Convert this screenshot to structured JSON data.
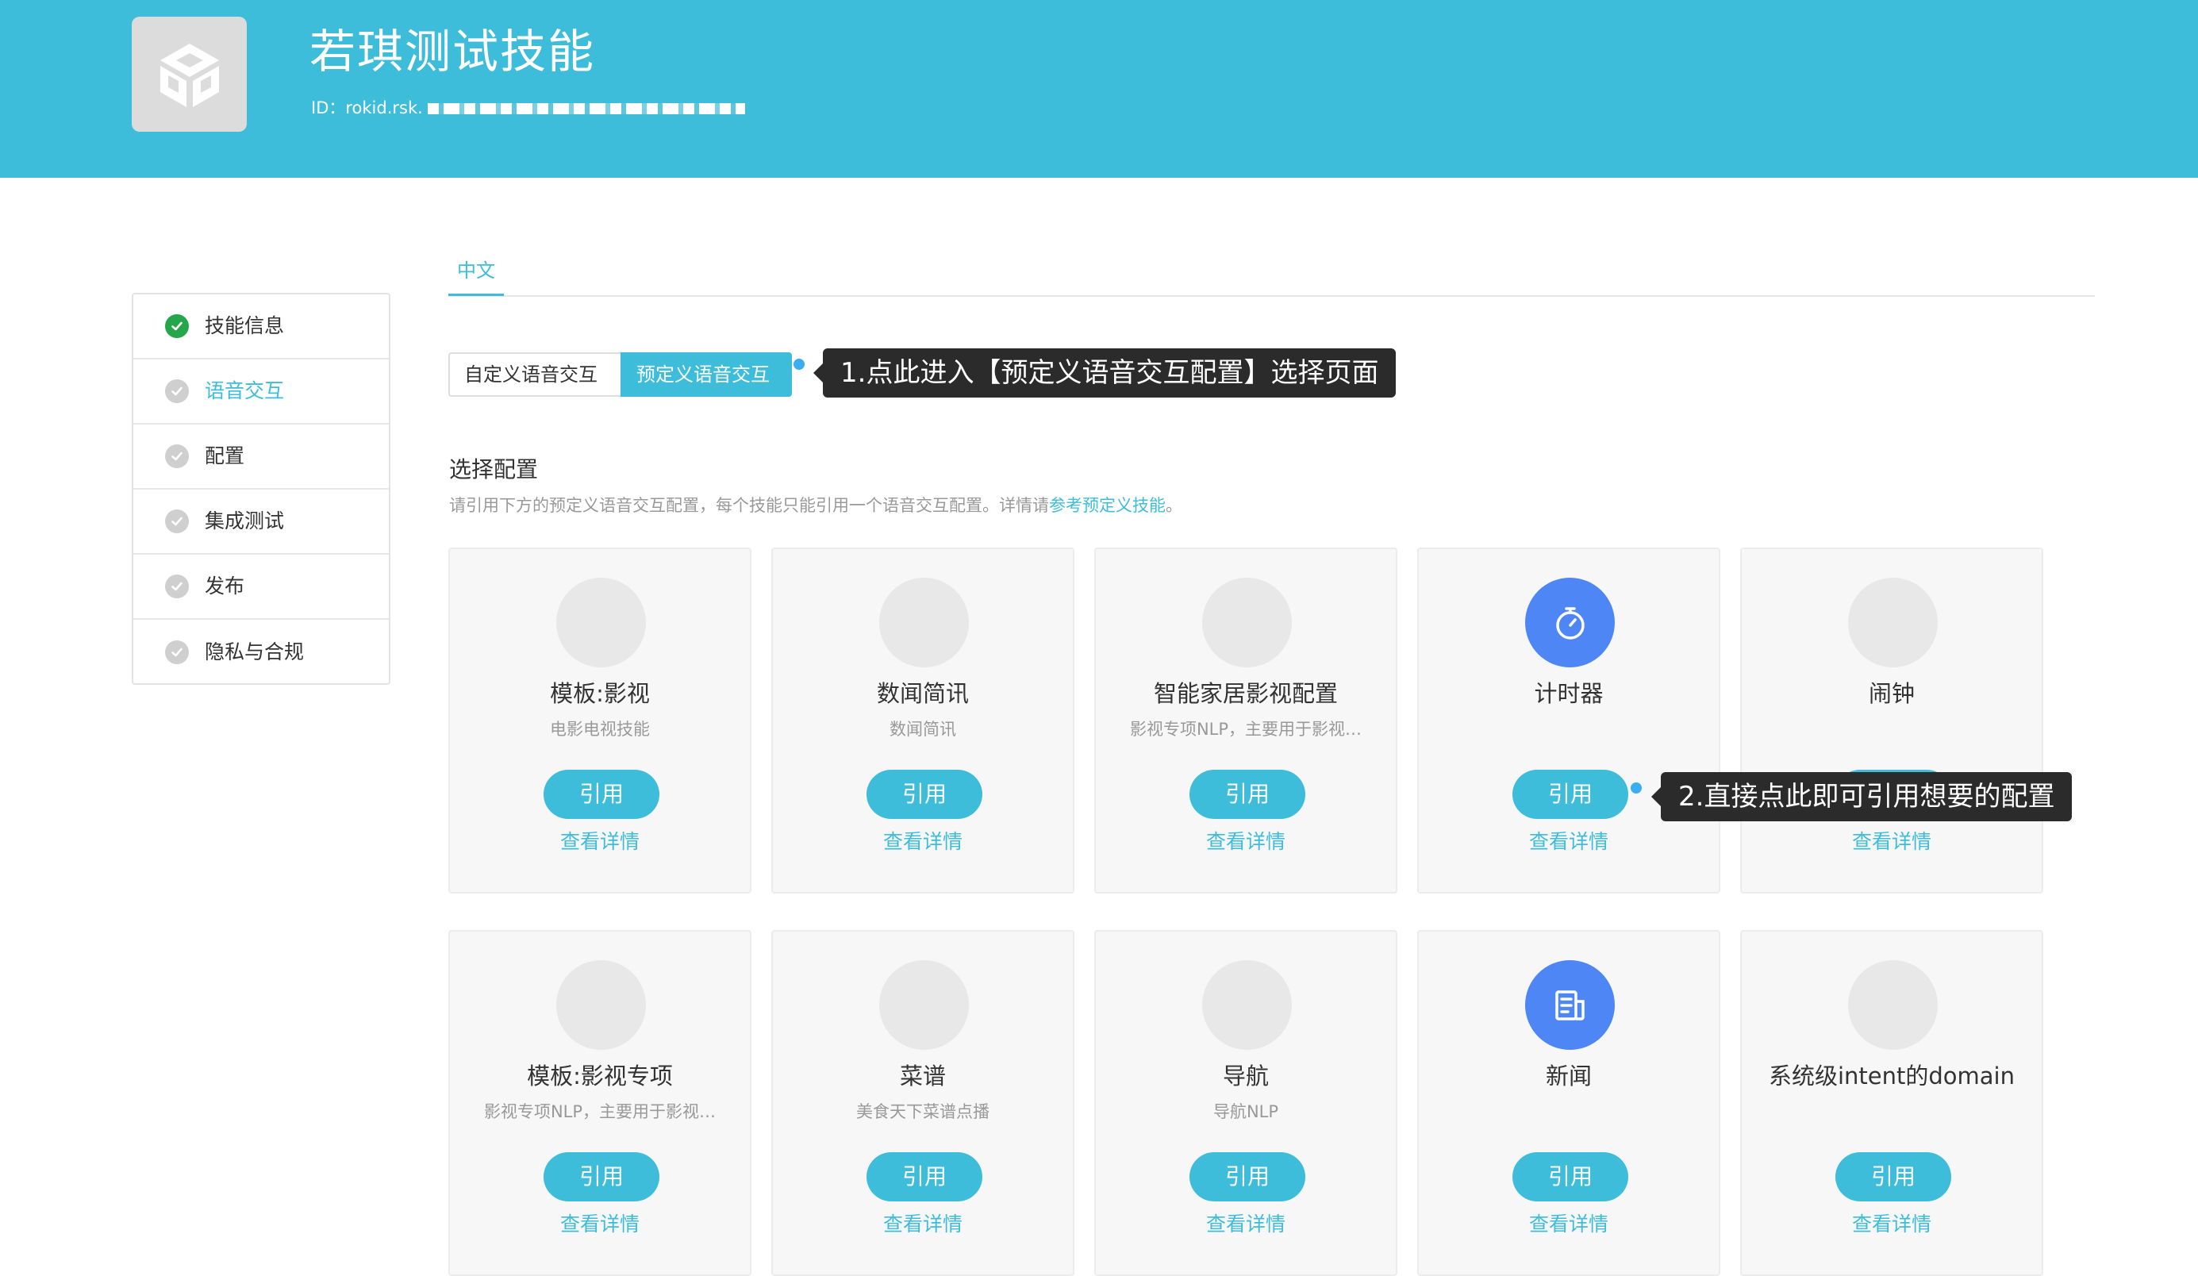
{
  "app": {
    "title": "若琪测试技能",
    "id_prefix": "ID：rokid.rsk.",
    "logo_icon": "cube-logo-icon"
  },
  "sidebar": {
    "items": [
      {
        "label": "技能信息",
        "status": "done"
      },
      {
        "label": "语音交互",
        "status": "pending",
        "active": true
      },
      {
        "label": "配置",
        "status": "pending"
      },
      {
        "label": "集成测试",
        "status": "pending"
      },
      {
        "label": "发布",
        "status": "pending"
      },
      {
        "label": "隐私与合规",
        "status": "pending"
      }
    ]
  },
  "language_tab": "中文",
  "segmented": {
    "custom": "自定义语音交互",
    "predefined": "预定义语音交互",
    "selected": "预定义语音交互"
  },
  "callouts": {
    "one": "1.点此进入【预定义语音交互配置】选择页面",
    "two": "2.直接点此即可引用想要的配置"
  },
  "section": {
    "title": "选择配置",
    "desc_prefix": "请引用下方的预定义语音交互配置，每个技能只能引用一个语音交互配置。详情请",
    "desc_link": "参考预定义技能",
    "desc_suffix": "。"
  },
  "cards": [
    {
      "title": "模板:影视",
      "subtitle": "电影电视技能",
      "button": "引用",
      "link": "查看详情",
      "icon": "placeholder"
    },
    {
      "title": "数闻简讯",
      "subtitle": "数闻简讯",
      "button": "引用",
      "link": "查看详情",
      "icon": "placeholder"
    },
    {
      "title": "智能家居影视配置",
      "subtitle": "影视专项NLP，主要用于影视…",
      "button": "引用",
      "link": "查看详情",
      "icon": "placeholder"
    },
    {
      "title": "计时器",
      "subtitle": "",
      "button": "引用",
      "link": "查看详情",
      "icon": "stopwatch-icon"
    },
    {
      "title": "闹钟",
      "subtitle": "",
      "button": "引用",
      "link": "查看详情",
      "icon": "placeholder"
    },
    {
      "title": "模板:影视专项",
      "subtitle": "影视专项NLP，主要用于影视…",
      "button": "引用",
      "link": "查看详情",
      "icon": "placeholder"
    },
    {
      "title": "菜谱",
      "subtitle": "美食天下菜谱点播",
      "button": "引用",
      "link": "查看详情",
      "icon": "placeholder"
    },
    {
      "title": "导航",
      "subtitle": "导航NLP",
      "button": "引用",
      "link": "查看详情",
      "icon": "placeholder"
    },
    {
      "title": "新闻",
      "subtitle": "",
      "button": "引用",
      "link": "查看详情",
      "icon": "news-icon"
    },
    {
      "title": "系统级intent的domain",
      "subtitle": "",
      "button": "引用",
      "link": "查看详情",
      "icon": "placeholder"
    }
  ],
  "colors": {
    "accent": "#3dbdda",
    "done": "#25a64a",
    "icon_blue": "#4e86f6",
    "callout_bg": "#2b2b2b"
  }
}
